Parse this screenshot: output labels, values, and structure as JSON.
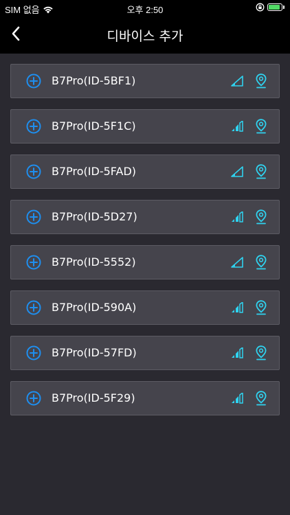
{
  "status_bar": {
    "carrier": "SIM 없음",
    "time": "오후 2:50"
  },
  "header": {
    "title": "디바이스 추가"
  },
  "colors": {
    "add_icon": "#1e8ff0",
    "signal_icon": "#2fd3f0",
    "location_icon": "#2fd3f0",
    "row_bg": "#45444c",
    "page_bg": "#2a2930"
  },
  "icons": {
    "add": "plus-circle-icon",
    "signal": "signal-strength-icon",
    "location": "location-pin-icon"
  },
  "devices": [
    {
      "name": "B7Pro(ID-5BF1)",
      "signal_bars": 1
    },
    {
      "name": "B7Pro(ID-5F1C)",
      "signal_bars": 3
    },
    {
      "name": "B7Pro(ID-5FAD)",
      "signal_bars": 1
    },
    {
      "name": "B7Pro(ID-5D27)",
      "signal_bars": 3
    },
    {
      "name": "B7Pro(ID-5552)",
      "signal_bars": 1
    },
    {
      "name": "B7Pro(ID-590A)",
      "signal_bars": 3
    },
    {
      "name": "B7Pro(ID-57FD)",
      "signal_bars": 3
    },
    {
      "name": "B7Pro(ID-5F29)",
      "signal_bars": 3
    }
  ]
}
